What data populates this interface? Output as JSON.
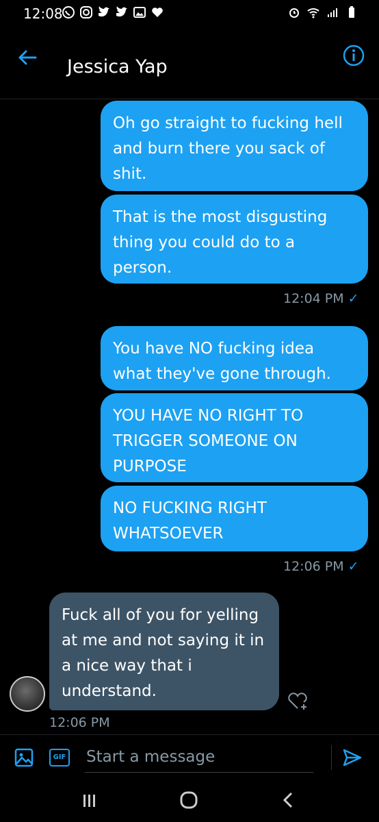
{
  "status_bar": {
    "time": "12:08",
    "left_icons": [
      "whatsapp-icon",
      "instagram-icon",
      "twitter-icon",
      "twitter-icon",
      "gallery-icon",
      "heart-icon"
    ],
    "right_icons": [
      "alarm-icon",
      "wifi-icon",
      "signal-icon",
      "battery-icon"
    ]
  },
  "header": {
    "title": "Jessica Yap"
  },
  "messages": [
    {
      "direction": "out",
      "text": "Oh go straight to fucking hell and burn there you sack of shit."
    },
    {
      "direction": "out",
      "text": "That is the most disgusting thing you could do to a person."
    },
    {
      "direction": "out",
      "text": "You have NO fucking idea what they've gone through."
    },
    {
      "direction": "out",
      "text": "YOU HAVE NO RIGHT TO TRIGGER SOMEONE ON PURPOSE"
    },
    {
      "direction": "out",
      "text": "NO FUCKING RIGHT WHATSOEVER"
    },
    {
      "direction": "in",
      "text": "Fuck all of you for yelling at me and not saying it in a nice way that i understand."
    }
  ],
  "timestamps": {
    "group1": "12:04 PM",
    "group2": "12:06 PM",
    "incoming": "12:06 PM"
  },
  "composer": {
    "placeholder": "Start a message",
    "gif_label": "GIF"
  },
  "colors": {
    "accent": "#1da1f2",
    "incoming_bubble": "#3d5466",
    "background": "#000000",
    "secondary_text": "#8899a6"
  }
}
